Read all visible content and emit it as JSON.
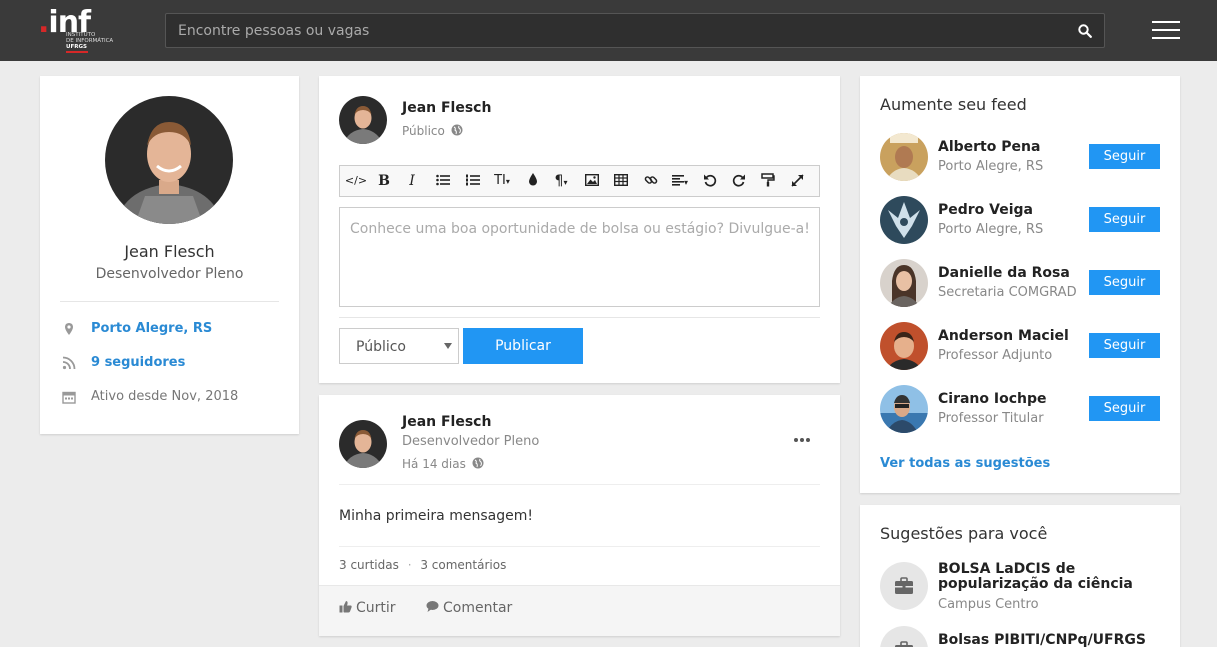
{
  "header": {
    "logo_mark": ".inf",
    "logo_sub_line1": "INSTITUTO",
    "logo_sub_line2": "DE INFORMÁTICA",
    "logo_sub_line3": "UFRGS",
    "search_placeholder": "Encontre pessoas ou vagas"
  },
  "profile": {
    "name": "Jean Flesch",
    "role": "Desenvolvedor Pleno",
    "location": "Porto Alegre, RS",
    "followers": "9 seguidores",
    "active_since": "Ativo desde Nov, 2018"
  },
  "composer": {
    "author": "Jean Flesch",
    "visibility": "Público",
    "placeholder": "Conhece uma boa oportunidade de bolsa ou estágio? Divulgue-a!",
    "select_value": "Público",
    "publish_label": "Publicar",
    "toolbar": [
      "code",
      "bold",
      "italic",
      "unordered-list",
      "ordered-list",
      "font-size",
      "color",
      "paragraph",
      "image",
      "table",
      "link",
      "align",
      "undo",
      "redo",
      "format-painter",
      "fullscreen"
    ]
  },
  "post": {
    "author": "Jean Flesch",
    "role": "Desenvolvedor Pleno",
    "time": "Há 14 dias",
    "message": "Minha primeira mensagem!",
    "likes": "3 curtidas",
    "separator": "·",
    "comments": "3 comentários",
    "like_label": "Curtir",
    "comment_label": "Comentar"
  },
  "feed": {
    "title": "Aumente seu feed",
    "follow_label": "Seguir",
    "see_all": "Ver todas as sugestões",
    "suggestions": [
      {
        "name": "Alberto Pena",
        "sub": "Porto Alegre, RS",
        "avatar_color": "#c9a15e"
      },
      {
        "name": "Pedro Veiga",
        "sub": "Porto Alegre, RS",
        "avatar_color": "#2e4a5c"
      },
      {
        "name": "Danielle da Rosa",
        "sub": "Secretaria COMGRAD",
        "avatar_color": "#8a7a70"
      },
      {
        "name": "Anderson Maciel",
        "sub": "Professor Adjunto",
        "avatar_color": "#c0502c"
      },
      {
        "name": "Cirano Iochpe",
        "sub": "Professor Titular",
        "avatar_color": "#5b8fc4"
      }
    ]
  },
  "jobs": {
    "title": "Sugestões para você",
    "items": [
      {
        "title": "BOLSA LaDCIS de popularização da ciência",
        "sub": "Campus Centro"
      },
      {
        "title": "Bolsas PIBITI/CNPq/UFRGS",
        "sub": ""
      }
    ]
  },
  "colors": {
    "topbar": "#3a3a3a",
    "accent": "#2196f3",
    "link": "#2a8ad4",
    "logo_red": "#d62828"
  }
}
